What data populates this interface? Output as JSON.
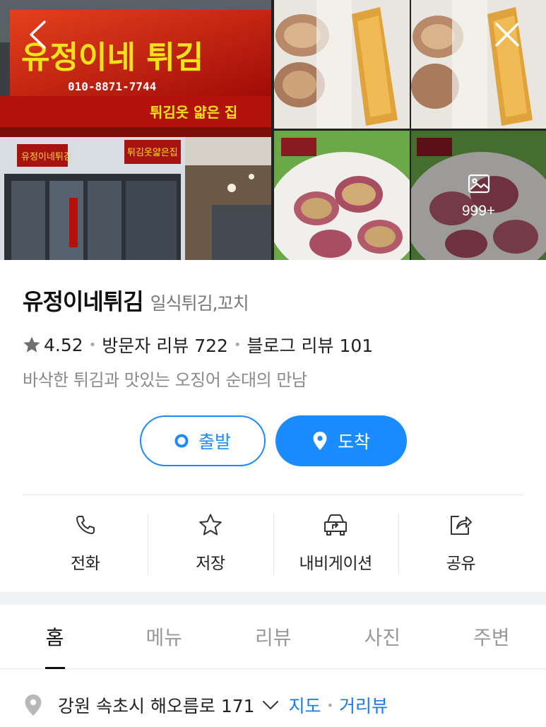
{
  "header": {
    "back_icon": "chevron-left-icon",
    "close_icon": "close-icon",
    "photo_more_count": "999+"
  },
  "place": {
    "name": "유정이네튀김",
    "category": "일식튀김,꼬치",
    "rating": "4.52",
    "visitor_reviews": "방문자 리뷰 722",
    "blog_reviews": "블로그 리뷰 101",
    "description": "바삭한 튀김과 맛있는 오징어 순대의 만남"
  },
  "route": {
    "depart_label": "출발",
    "arrive_label": "도착"
  },
  "actions": [
    {
      "label": "전화",
      "icon": "phone-icon"
    },
    {
      "label": "저장",
      "icon": "star-outline-icon"
    },
    {
      "label": "내비게이션",
      "icon": "car-navigation-icon"
    },
    {
      "label": "공유",
      "icon": "share-icon"
    }
  ],
  "tabs": [
    {
      "label": "홈",
      "active": true
    },
    {
      "label": "메뉴",
      "active": false
    },
    {
      "label": "리뷰",
      "active": false
    },
    {
      "label": "사진",
      "active": false
    },
    {
      "label": "주변",
      "active": false
    }
  ],
  "address": {
    "text": "강원 속초시 해오름로 171",
    "map_link": "지도",
    "street_view_link": "거리뷰"
  },
  "colors": {
    "accent": "#1a8cff",
    "link": "#1a7be8",
    "muted": "#8a8a8a"
  }
}
